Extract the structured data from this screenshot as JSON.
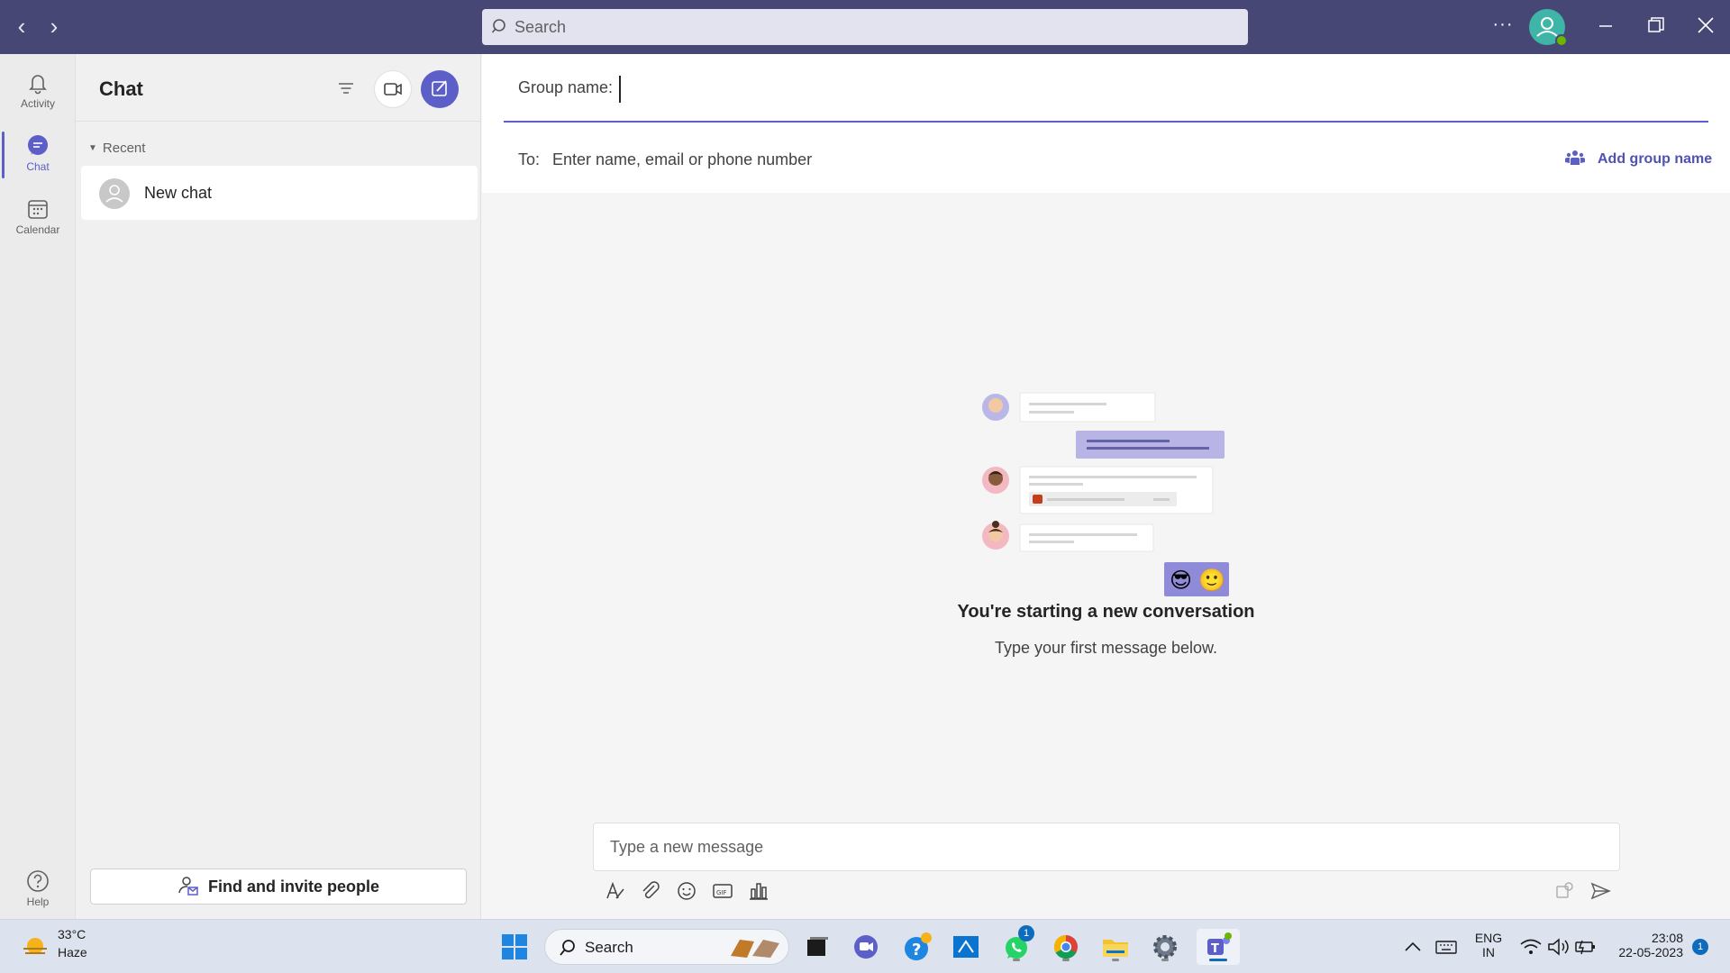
{
  "titlebar": {
    "search_placeholder": "Search",
    "more_label": "···"
  },
  "rail": {
    "items": [
      {
        "label": "Activity",
        "icon": "bell-icon"
      },
      {
        "label": "Chat",
        "icon": "chat-icon",
        "active": true
      },
      {
        "label": "Calendar",
        "icon": "calendar-icon"
      }
    ],
    "help_label": "Help"
  },
  "chat_pane": {
    "title": "Chat",
    "recent_label": "Recent",
    "items": [
      {
        "name": "New chat"
      }
    ],
    "invite_label": "Find and invite people"
  },
  "main": {
    "group_name_label": "Group name:",
    "group_name_value": "",
    "to_label": "To:",
    "to_placeholder": "Enter name, email or phone number",
    "add_group_label": "Add group name",
    "empty_title": "You're starting a new conversation",
    "empty_subtitle": "Type your first message below.",
    "composer_placeholder": "Type a new message",
    "emoji_reactions": [
      "😎",
      "🙂"
    ]
  },
  "taskbar": {
    "weather_temp": "33°C",
    "weather_condition": "Haze",
    "search_label": "Search",
    "whatsapp_badge": "1",
    "lang_line1": "ENG",
    "lang_line2": "IN",
    "time": "23:08",
    "date": "22-05-2023",
    "notification_count": "1"
  },
  "colors": {
    "titlebar": "#464775",
    "accent": "#5b5fc7",
    "link": "#4f52b2"
  }
}
